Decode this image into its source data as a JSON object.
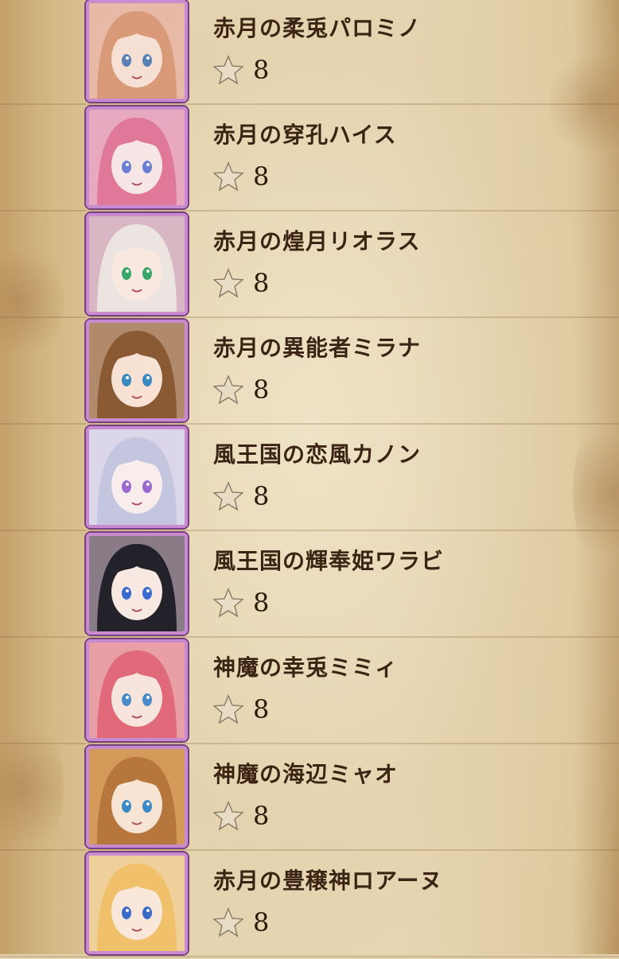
{
  "colors": {
    "name_text": "#3b2413",
    "star_fill": "#e8dcc4",
    "star_stroke": "#8a7a66",
    "frame": "#c98bd0"
  },
  "units": [
    {
      "name": "赤月の柔兎パロミノ",
      "rarity": "8",
      "icon": "hero-portrait-icon",
      "hair": "#d99a7a",
      "skin": "#f6e0d4",
      "eyes": "#5a80b8",
      "bg": "#e7b9a6"
    },
    {
      "name": "赤月の穿孔ハイス",
      "rarity": "8",
      "icon": "hero-portrait-icon",
      "hair": "#e0789a",
      "skin": "#f7e6e6",
      "eyes": "#6a7fd0",
      "bg": "#e8a9c0"
    },
    {
      "name": "赤月の煌月リオラス",
      "rarity": "8",
      "icon": "hero-portrait-icon",
      "hair": "#ece4e0",
      "skin": "#f9e8e0",
      "eyes": "#3aa66a",
      "bg": "#d9b6c4"
    },
    {
      "name": "赤月の異能者ミラナ",
      "rarity": "8",
      "icon": "hero-portrait-icon",
      "hair": "#8a5a34",
      "skin": "#f8e2d4",
      "eyes": "#3a8ac0",
      "bg": "#b08a6a"
    },
    {
      "name": "風王国の恋風カノン",
      "rarity": "8",
      "icon": "hero-portrait-icon",
      "hair": "#c4c6e0",
      "skin": "#f8ecec",
      "eyes": "#9a6ad0",
      "bg": "#dcd6ea"
    },
    {
      "name": "風王国の輝奉姫ワラビ",
      "rarity": "8",
      "icon": "hero-portrait-icon",
      "hair": "#23222a",
      "skin": "#f7e8e2",
      "eyes": "#3a6ad0",
      "bg": "#8a7c86"
    },
    {
      "name": "神魔の幸兎ミミィ",
      "rarity": "8",
      "icon": "hero-portrait-icon",
      "hair": "#e06a7a",
      "skin": "#f7e4dc",
      "eyes": "#4a8ac8",
      "bg": "#e8a0a6"
    },
    {
      "name": "神魔の海辺ミャオ",
      "rarity": "8",
      "icon": "hero-portrait-icon",
      "hair": "#b6763c",
      "skin": "#f8e4d2",
      "eyes": "#3a8ac8",
      "bg": "#d49a5a"
    },
    {
      "name": "赤月の豊穣神ロアーヌ",
      "rarity": "8",
      "icon": "hero-portrait-icon",
      "hair": "#f0c06a",
      "skin": "#f9e8da",
      "eyes": "#3a6ac8",
      "bg": "#f0d09a"
    }
  ]
}
